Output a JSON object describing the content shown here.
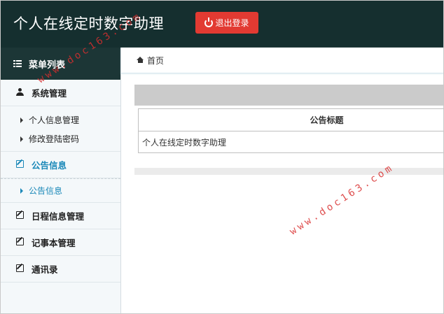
{
  "header": {
    "app_title": "个人在线定时数字助理",
    "logout_label": "退出登录"
  },
  "sidebar": {
    "menu_title": "菜单列表",
    "groups": [
      {
        "label": "系统管理",
        "icon": "user-icon",
        "items": [
          "个人信息管理",
          "修改登陆密码"
        ]
      },
      {
        "label": "公告信息",
        "icon": "edit-icon",
        "items": [
          "公告信息"
        ],
        "active": true
      },
      {
        "label": "日程信息管理",
        "icon": "edit-icon"
      },
      {
        "label": "记事本管理",
        "icon": "edit-icon"
      },
      {
        "label": "通讯录",
        "icon": "edit-icon"
      }
    ]
  },
  "main": {
    "breadcrumb": "首页",
    "table": {
      "header": "公告标题",
      "rows": [
        "个人在线定时数字助理"
      ]
    }
  },
  "watermark": "www.doc163.com",
  "colors": {
    "topbar": "#152f2f",
    "logout": "#e23a32",
    "active": "#1a88b8",
    "watermark": "#d92e2e"
  }
}
